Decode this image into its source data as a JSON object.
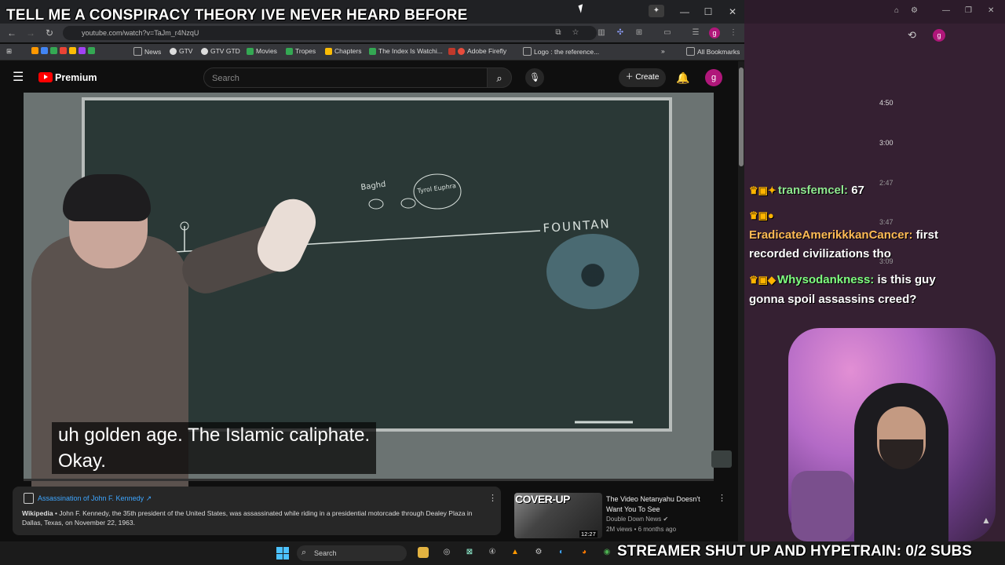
{
  "overlay": {
    "top_title": "TELL ME A CONSPIRACY THEORY IVE NEVER HEARD BEFORE",
    "bottom_banner": "STREAMER SHUT UP AND HYPETRAIN: 0/2 SUBS"
  },
  "browser": {
    "url": "youtube.com/watch?v=TaJm_r4NzqU",
    "bookmarks": [
      "News",
      "GTV",
      "GTV GTD",
      "Movies",
      "Tropes",
      "Chapters",
      "The Index Is Watchi...",
      "Adobe Firefly",
      "Logo : the reference...",
      "All Bookmarks"
    ]
  },
  "youtube": {
    "brand": "Premium",
    "search_placeholder": "Search",
    "create_label": "Create",
    "avatar_letter": "g",
    "caption_line1": "uh golden age. The Islamic caliphate.",
    "caption_line2": "Okay.",
    "info_card": {
      "title": "Assassination of John F. Kennedy ↗",
      "source": "Wikipedia",
      "text": " • John F. Kennedy, the 35th president of the United States, was assassinated while riding in a presidential motorcade through Dealey Plaza in Dallas, Texas, on November 22, 1963."
    },
    "recommendation": {
      "thumb_text": "COVER-UP",
      "duration": "12:27",
      "title": "The Video Netanyahu Doesn't Want You To See",
      "channel": "Double Down News",
      "meta": "2M views • 6 months ago"
    },
    "whiteboard_text": [
      "Baghd",
      "Tyrol Euphra",
      "FOUNTAN"
    ]
  },
  "stream_panel": {
    "timestamps": [
      "4:50",
      "3:00",
      "2:47",
      "3:47",
      "3:09"
    ],
    "chat": [
      {
        "user": "transfemcel:",
        "message": "67",
        "user_color": "#8fe88f"
      },
      {
        "user": "EradicateAmerikkkanCancer:",
        "message": "first",
        "message2": "recorded civilizations tho",
        "user_color": "#ffbb55"
      },
      {
        "user": "Whysodankness:",
        "message": "is this guy",
        "message2": "gonna spoil assassins creed?",
        "user_color": "#7fff7f"
      }
    ],
    "avatar_letter": "g"
  },
  "taskbar": {
    "search_placeholder": "Search"
  },
  "icons": [
    "back-icon",
    "forward-icon",
    "reload-icon",
    "star-icon",
    "search-icon",
    "mic-icon",
    "bell-icon",
    "hamburger-icon",
    "history-icon",
    "windows-logo-icon"
  ]
}
